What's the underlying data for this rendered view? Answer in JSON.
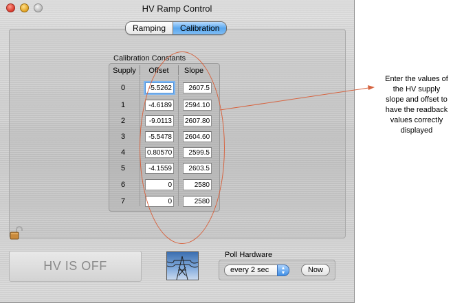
{
  "window": {
    "title": "HV Ramp Control"
  },
  "tabs": [
    {
      "label": "Ramping",
      "active": false
    },
    {
      "label": "Calibration",
      "active": true
    }
  ],
  "calibration": {
    "group_title": "Calibration Constants",
    "headers": {
      "supply": "Supply",
      "offset": "Offset",
      "slope": "Slope"
    },
    "rows": [
      {
        "supply": "0",
        "offset": "-5.5262",
        "slope": "2607.5"
      },
      {
        "supply": "1",
        "offset": "-4.6189",
        "slope": "2594.106"
      },
      {
        "supply": "2",
        "offset": "-9.0113",
        "slope": "2607.800"
      },
      {
        "supply": "3",
        "offset": "-5.5478",
        "slope": "2604.606"
      },
      {
        "supply": "4",
        "offset": "0.80570",
        "slope": "2599.5"
      },
      {
        "supply": "5",
        "offset": "-4.1559",
        "slope": "2603.5"
      },
      {
        "supply": "6",
        "offset": "0",
        "slope": "2580"
      },
      {
        "supply": "7",
        "offset": "0",
        "slope": "2580"
      }
    ]
  },
  "hv_button": {
    "label": "HV IS OFF"
  },
  "poll": {
    "title": "Poll Hardware",
    "selected": "every 2 sec",
    "now_label": "Now"
  },
  "annotation": {
    "lines": [
      "Enter the values of",
      "the HV supply",
      "slope and offset to",
      "have the readback",
      "values correctly",
      "displayed"
    ],
    "color": "#d6633f"
  },
  "icons": {
    "lock": "unlocked-padlock-icon",
    "image": "power-tower-icon",
    "popup_arrows": "updown-arrows-icon"
  }
}
